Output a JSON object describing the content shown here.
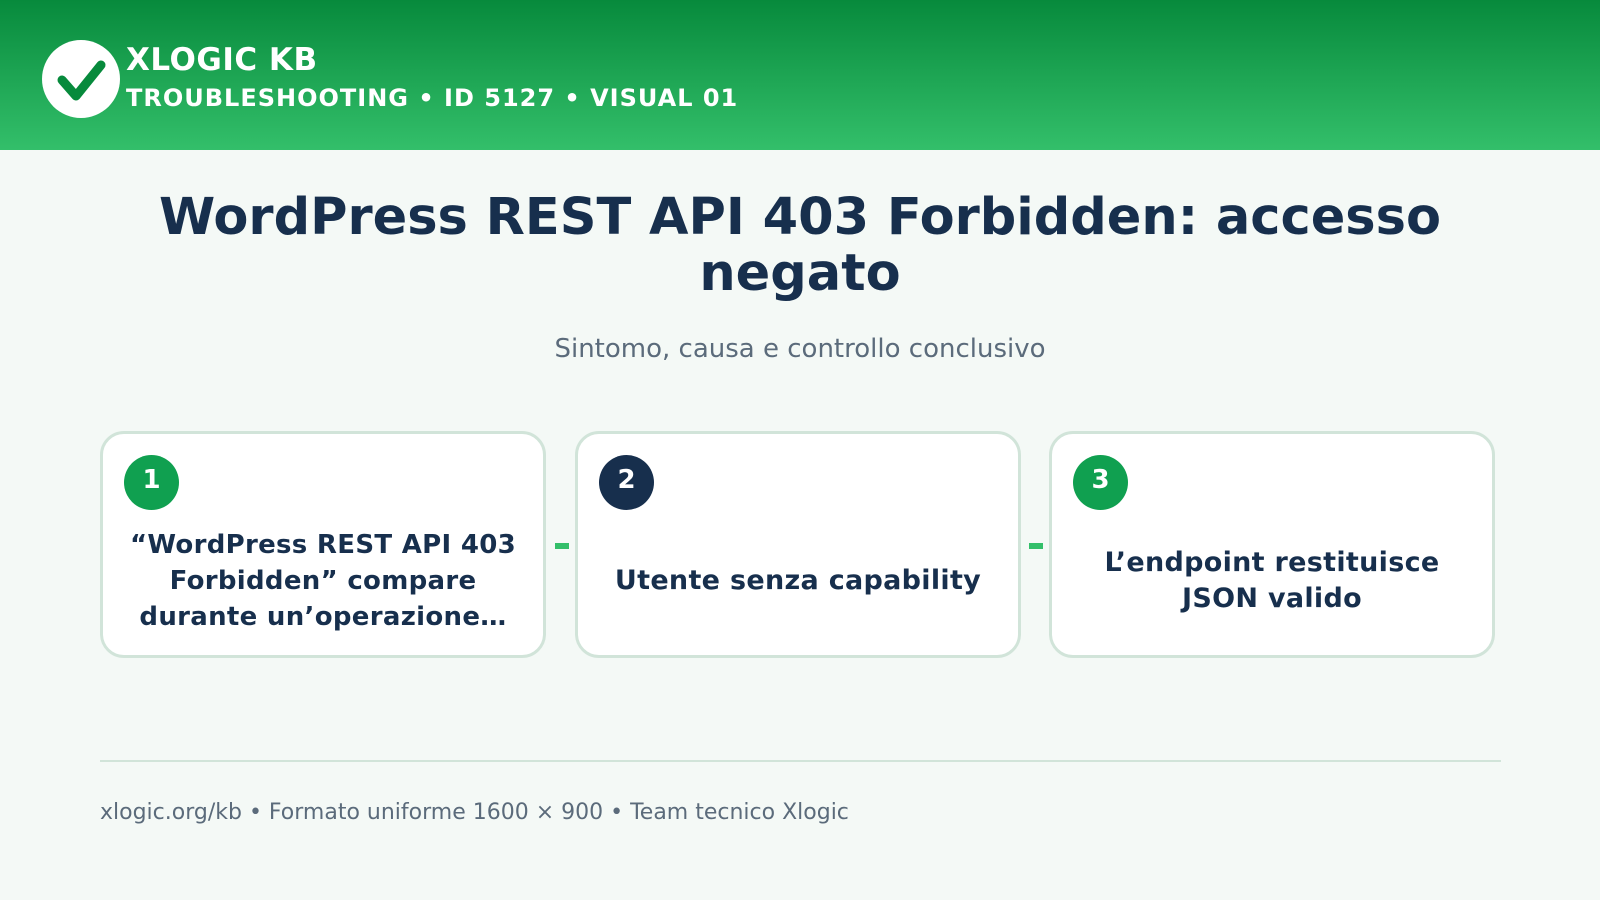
{
  "header": {
    "brand": "XLOGIC KB",
    "meta": "TROUBLESHOOTING • ID 5127 • VISUAL 01",
    "logo_icon": "check-circle-icon"
  },
  "title": "WordPress REST API 403 Forbidden: accesso negato",
  "subtitle": "Sintomo, causa e controllo conclusivo",
  "steps": [
    {
      "number": "1",
      "text": "“WordPress REST API 403 Forbidden” compare durante un’operazione…"
    },
    {
      "number": "2",
      "text": "Utente senza capability"
    },
    {
      "number": "3",
      "text": "L’endpoint restituisce JSON valido"
    }
  ],
  "footer": "xlogic.org/kb • Formato uniforme 1600 × 900 • Team tecnico Xlogic",
  "colors": {
    "header_top": "#078a3c",
    "header_bottom": "#33bf6a",
    "badge_green": "#10a050",
    "badge_navy": "#172f4d",
    "text_dark": "#172f4d",
    "text_muted": "#5b6b7b"
  }
}
